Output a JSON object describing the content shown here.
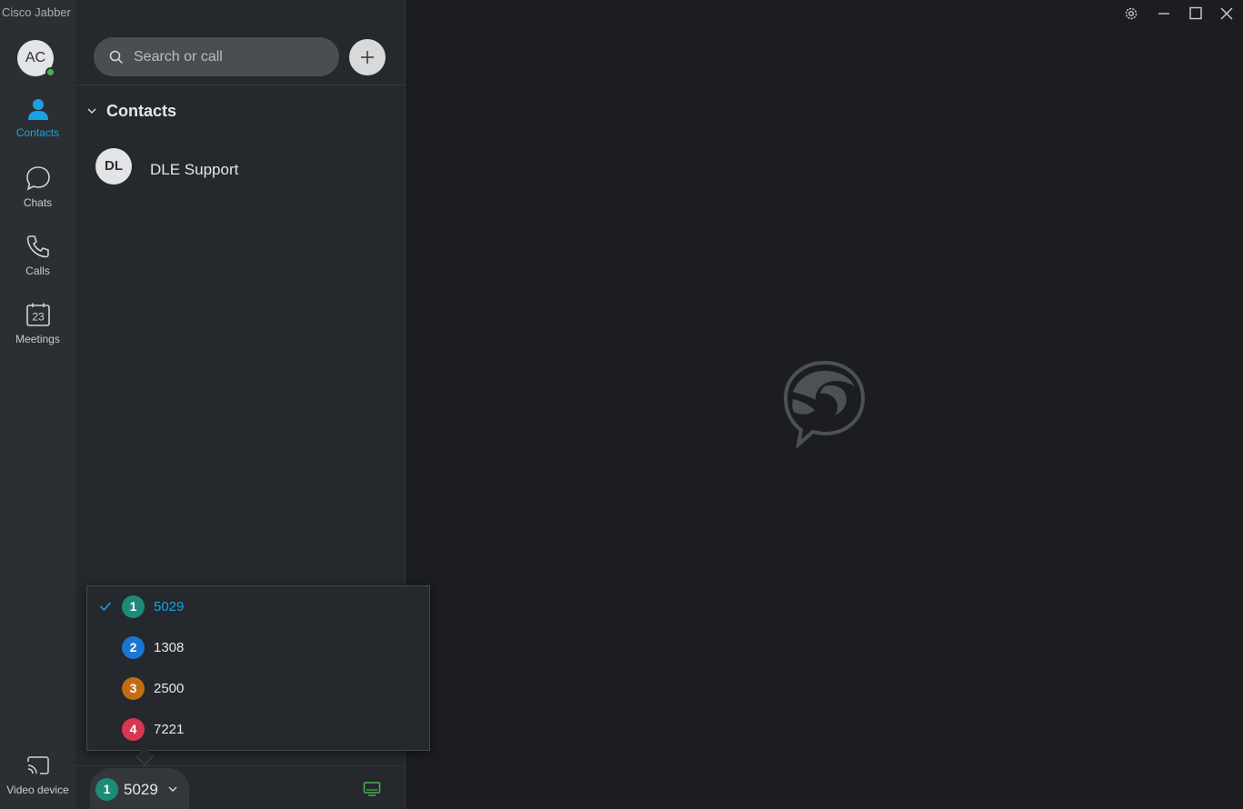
{
  "app": {
    "title": "Cisco Jabber"
  },
  "user": {
    "initials": "AC",
    "status_color": "#4caf50"
  },
  "nav": {
    "contacts": "Contacts",
    "chats": "Chats",
    "calls": "Calls",
    "meetings": "Meetings",
    "calendar_day": "23",
    "video_device": "Video device"
  },
  "search": {
    "placeholder": "Search or call",
    "value": ""
  },
  "contacts": {
    "group_title": "Contacts",
    "items": [
      {
        "initials": "DL",
        "name": "DLE Support"
      }
    ]
  },
  "lines": {
    "items": [
      {
        "index": "1",
        "number": "5029",
        "color": "#1e8a78",
        "selected": true
      },
      {
        "index": "2",
        "number": "1308",
        "color": "#1976d2",
        "selected": false
      },
      {
        "index": "3",
        "number": "2500",
        "color": "#c16d12",
        "selected": false
      },
      {
        "index": "4",
        "number": "7221",
        "color": "#d9364f",
        "selected": false
      }
    ],
    "current": {
      "index": "1",
      "number": "5029"
    }
  },
  "icons": {
    "search": "search-icon",
    "add": "plus-icon",
    "settings": "gear-icon",
    "minimize": "minimize-icon",
    "maximize": "maximize-icon",
    "close": "close-icon",
    "desk_phone": "desk-phone-icon",
    "logo": "jabber-logo-icon"
  },
  "colors": {
    "accent": "#1ba1e2",
    "rail_bg": "#2b2f34",
    "panel_bg": "#25282c",
    "main_bg": "#1b1d21",
    "desk_phone_green": "#4caf50"
  }
}
